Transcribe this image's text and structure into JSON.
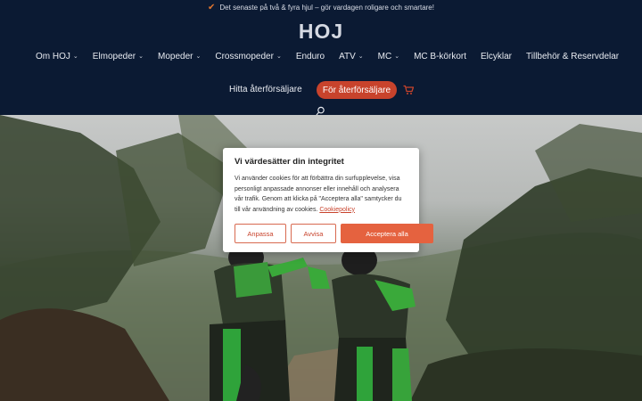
{
  "announcement": {
    "text": "Det senaste på två & fyra hjul – gör vardagen roligare och smartare!",
    "icon": "checkmark-icon",
    "icon_color": "#e0742e"
  },
  "brand": {
    "logo_text": "HOJ"
  },
  "nav": {
    "items": [
      {
        "label": "Om HOJ",
        "dropdown": true
      },
      {
        "label": "Elmopeder",
        "dropdown": true
      },
      {
        "label": "Mopeder",
        "dropdown": true
      },
      {
        "label": "Crossmopeder",
        "dropdown": true
      },
      {
        "label": "Enduro",
        "dropdown": false
      },
      {
        "label": "ATV",
        "dropdown": true
      },
      {
        "label": "MC",
        "dropdown": true
      },
      {
        "label": "MC B-körkort",
        "dropdown": false
      },
      {
        "label": "Elcyklar",
        "dropdown": false
      },
      {
        "label": "Tillbehör & Reservdelar",
        "dropdown": false
      }
    ],
    "find_dealer": "Hitta återförsäljare",
    "for_dealer_button": "För återförsäljare"
  },
  "cookie": {
    "title": "Vi värdesätter din integritet",
    "body": "Vi använder cookies för att förbättra din surfupplevelse, visa personligt anpassade annonser eller innehåll och analysera vår trafik. Genom att klicka på \"Acceptera alla\" samtycker du till vår användning av cookies.",
    "policy_link": "Cookiepolicy",
    "customize_label": "Anpassa",
    "reject_label": "Avvisa",
    "accept_label": "Acceptera alla"
  },
  "colors": {
    "background": "#0b1a33",
    "accent": "#c8432c",
    "accept_button": "#e5623f"
  }
}
